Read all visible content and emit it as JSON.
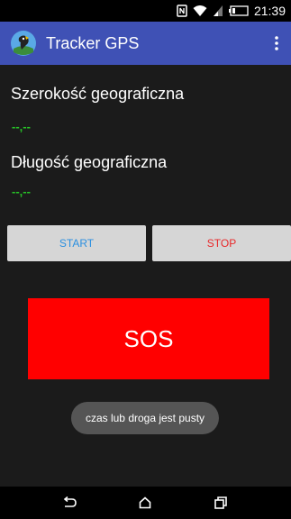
{
  "status_bar": {
    "time": "21:39",
    "icons": [
      "nfc-icon",
      "wifi-icon",
      "signal-icon",
      "battery-icon"
    ]
  },
  "app_bar": {
    "title": "Tracker GPS",
    "logo_icon": "parrot-logo-icon",
    "menu_icon": "overflow-menu-icon",
    "background_color": "#3f51b5"
  },
  "main": {
    "latitude_label": "Szerokość geograficzna",
    "latitude_value": "--,--",
    "longitude_label": "Długość geograficzna",
    "longitude_value": "--,--",
    "value_color": "#27c227"
  },
  "buttons": {
    "start_label": "START",
    "stop_label": "STOP",
    "sos_label": "SOS",
    "sos_color": "#ff0000"
  },
  "toast": {
    "message": "czas lub droga jest pusty"
  },
  "nav_bar": {
    "icons": [
      "back-icon",
      "home-icon",
      "recent-apps-icon"
    ]
  }
}
